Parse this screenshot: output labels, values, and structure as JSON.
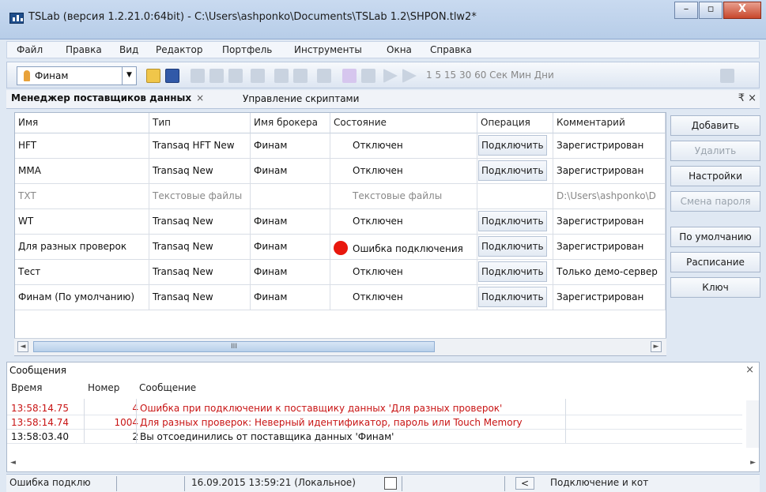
{
  "window": {
    "title": "TSLab (версия 1.2.21.0:64bit) - C:\\Users\\ashponko\\Documents\\TSLab 1.2\\SHPON.tlw2*",
    "minimize": "–",
    "maximize": "▫",
    "close": "X"
  },
  "menu": [
    "Файл",
    "Правка",
    "Вид",
    "Редактор",
    "Портфель",
    "Инструменты",
    "Окна",
    "Справка"
  ],
  "toolbar": {
    "combo_value": "Финам",
    "timeframes": "1 5 15 30 60 Сек Мин Дни"
  },
  "tabs": {
    "active": "Менеджер поставщиков данных",
    "close": "×",
    "second": "Управление скриптами",
    "pin": "₹ ×"
  },
  "grid": {
    "columns": [
      "Имя",
      "Тип",
      "Имя брокера",
      "Состояние",
      "Операция",
      "Комментарий"
    ],
    "rows": [
      {
        "name": "HFT",
        "type": "Transaq HFT New",
        "broker": "Финам",
        "state": "Отключен",
        "op": "Подключить",
        "comment": "Зарегистрирован",
        "error": false,
        "disabled": false
      },
      {
        "name": "MMA",
        "type": "Transaq New",
        "broker": "Финам",
        "state": "Отключен",
        "op": "Подключить",
        "comment": "Зарегистрирован",
        "error": false,
        "disabled": false
      },
      {
        "name": "TXT",
        "type": "Текстовые файлы",
        "broker": "",
        "state": "Текстовые файлы",
        "op": "",
        "comment": "D:\\Users\\ashponko\\D",
        "error": false,
        "disabled": true
      },
      {
        "name": "WT",
        "type": "Transaq New",
        "broker": "Финам",
        "state": "Отключен",
        "op": "Подключить",
        "comment": "Зарегистрирован",
        "error": false,
        "disabled": false
      },
      {
        "name": "Для разных проверок",
        "type": "Transaq New",
        "broker": "Финам",
        "state": "Ошибка подключения",
        "op": "Подключить",
        "comment": "Зарегистрирован",
        "error": true,
        "disabled": false
      },
      {
        "name": "Тест",
        "type": "Transaq New",
        "broker": "Финам",
        "state": "Отключен",
        "op": "Подключить",
        "comment": "Только демо-сервер",
        "error": false,
        "disabled": false
      },
      {
        "name": "Финам (По умолчанию)",
        "type": "Transaq New",
        "broker": "Финам",
        "state": "Отключен",
        "op": "Подключить",
        "comment": "Зарегистрирован",
        "error": false,
        "disabled": false
      }
    ],
    "scroll_thumb": "III"
  },
  "side_buttons": [
    {
      "label": "Добавить",
      "enabled": true
    },
    {
      "label": "Удалить",
      "enabled": false
    },
    {
      "label": "Настройки",
      "enabled": true
    },
    {
      "label": "Смена пароля",
      "enabled": false
    },
    {
      "label": "По умолчанию",
      "enabled": true
    },
    {
      "label": "Расписание",
      "enabled": true
    },
    {
      "label": "Ключ",
      "enabled": true
    }
  ],
  "messages": {
    "title": "Сообщения",
    "close": "×",
    "columns": [
      "Время",
      "Номер",
      "Сообщение"
    ],
    "rows": [
      {
        "time": "13:58:14.75",
        "num": "4",
        "text": "Ошибка при подключении к поставщику данных 'Для разных проверок'",
        "error": true
      },
      {
        "time": "13:58:14.74",
        "num": "1004",
        "text": "Для разных проверок: Неверный идентификатор, пароль или Touch Memory",
        "error": true
      },
      {
        "time": "13:58:03.40",
        "num": "2",
        "text": "Вы отсоединились от поставщика данных 'Финам'",
        "error": false
      }
    ]
  },
  "status": {
    "left": "Ошибка подклю",
    "datetime": "16.09.2015 13:59:21 (Локальное)",
    "nav_left": "<",
    "right": "Подключение и кот"
  },
  "colors": {
    "error": "#c81414",
    "error_dot": "#e8170d",
    "accent": "#1f4e8c"
  }
}
